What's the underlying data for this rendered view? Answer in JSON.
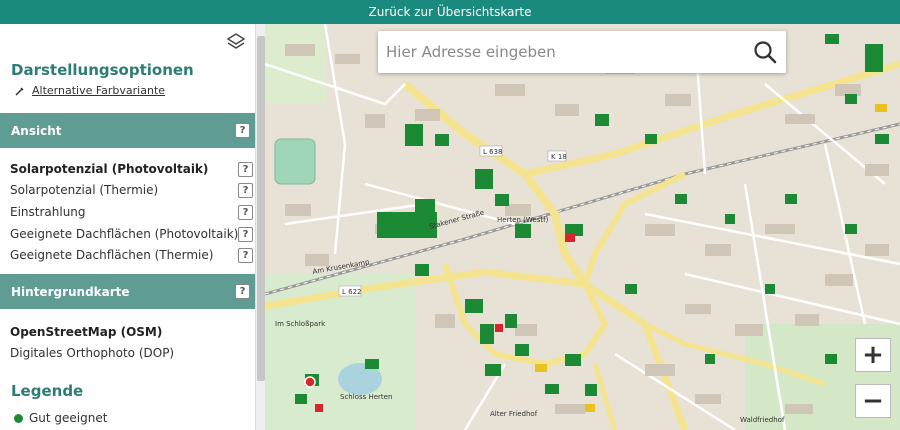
{
  "topbar": {
    "label": "Zurück zur Übersichtskarte"
  },
  "sidebar": {
    "title": "Darstellungsoptionen",
    "alt_color_label": "Alternative Farbvariante",
    "sections": {
      "ansicht": {
        "label": "Ansicht",
        "help": "?"
      },
      "hintergrund": {
        "label": "Hintergrundkarte",
        "help": "?"
      }
    },
    "ansicht_options": [
      {
        "label": "Solarpotenzial (Photovoltaik)",
        "selected": true
      },
      {
        "label": "Solarpotenzial (Thermie)",
        "selected": false
      },
      {
        "label": "Einstrahlung",
        "selected": false
      },
      {
        "label": "Geeignete Dachflächen (Photovoltaik)",
        "selected": false
      },
      {
        "label": "Geeignete Dachflächen (Thermie)",
        "selected": false
      }
    ],
    "help_label": "?",
    "background_options": [
      {
        "label": "OpenStreetMap (OSM)",
        "selected": true
      },
      {
        "label": "Digitales Orthophoto (DOP)",
        "selected": false
      }
    ],
    "legend": {
      "title": "Legende",
      "items": [
        {
          "label": "Gut geeignet",
          "color": "#1c8a35"
        }
      ]
    }
  },
  "search": {
    "placeholder": "Hier Adresse eingeben"
  },
  "zoom": {
    "in_label": "+",
    "out_label": "−"
  },
  "map": {
    "labels": {
      "road1": "L 638",
      "road2": "K 18",
      "road3": "L 622",
      "street1": "Stakener Straße",
      "street2": "Am Krusenkamp",
      "street3": "Im Schloßpark",
      "place1": "Schloss Herten",
      "place2": "Alter Friedhof",
      "place3": "Waldfriedhof",
      "place4": "Herten (Westf)"
    }
  },
  "colors": {
    "accent": "#1b8a7e",
    "section": "#5f9c94",
    "title": "#2d7d74",
    "roof_green": "#1c8a35"
  }
}
